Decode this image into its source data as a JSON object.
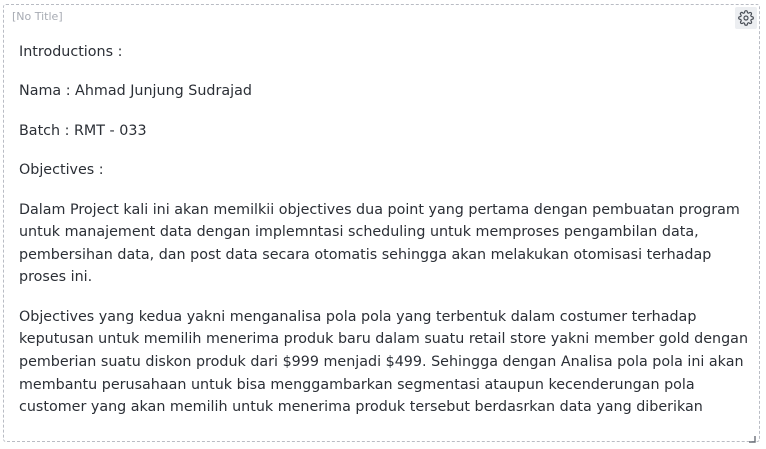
{
  "panel": {
    "title": "[No Title]",
    "settings_icon": "gear-icon",
    "resize_icon": "resize-corner-icon"
  },
  "content": {
    "introductions": "Introductions :",
    "nama": "Nama : Ahmad Junjung Sudrajad",
    "batch": "Batch : RMT - 033",
    "objectives_heading": "Objectives :",
    "objective_1": "Dalam Project kali ini akan memilkii objectives dua point yang pertama dengan pembuatan program untuk manajement data dengan implemntasi scheduling untuk memproses pengambilan data, pembersihan data, dan post data secara otomatis sehingga akan melakukan otomisasi terhadap proses ini.",
    "objective_2": "Objectives yang kedua yakni menganalisa pola pola yang terbentuk dalam costumer terhadap keputusan untuk memilih menerima produk baru dalam suatu retail store yakni member gold dengan pemberian suatu diskon produk dari $999 menjadi $499. Sehingga dengan Analisa pola pola ini akan membantu perusahaan untuk bisa menggambarkan segmentasi ataupun kecenderungan pola customer yang akan memilih untuk menerima produk tersebut berdasrkan data yang diberikan"
  }
}
